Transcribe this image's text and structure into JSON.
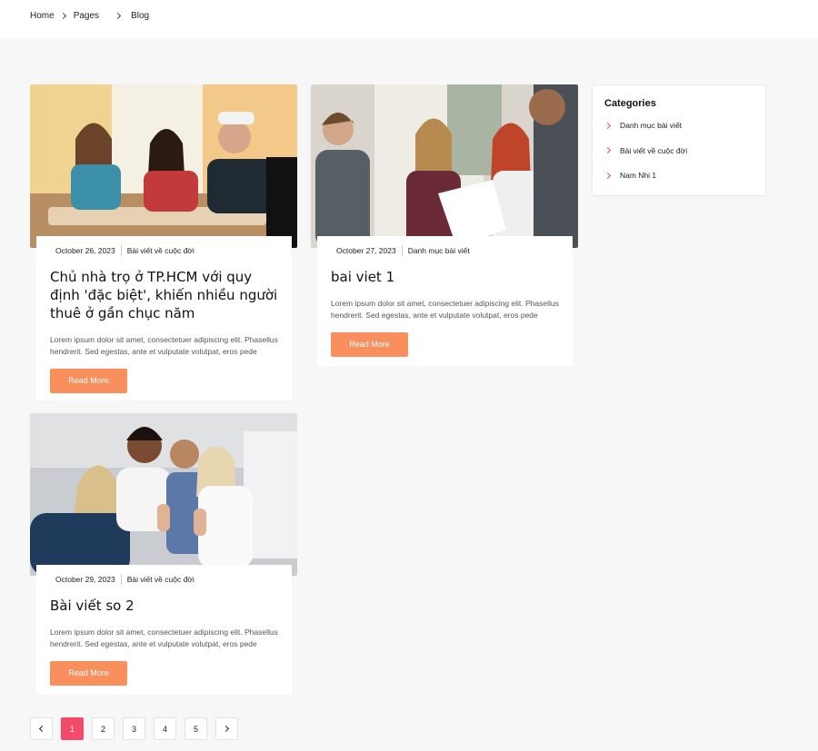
{
  "breadcrumb": {
    "home": "Home",
    "pages": "Pages",
    "current": "Blog"
  },
  "posts": [
    {
      "date": "October 26, 2023",
      "category": "Bài viết về cuộc đời",
      "title": "Chủ nhà trọ ở TP.HCM với quy định 'đặc biệt', khiến nhiều người thuê ở gần chục năm",
      "excerpt": "Lorem ipsum dolor sit amet, consectetuer adipiscing elit. Phasellus hendrerit. Sed egestas, ante et vulputate volutpat, eros pede",
      "button": "Read More",
      "image": "students-classroom-photo"
    },
    {
      "date": "October 27, 2023",
      "category": "Danh mục bài viết",
      "title": "bai viet 1",
      "excerpt": "Lorem ipsum dolor sit amet, consectetuer adipiscing elit. Phasellus hendrerit. Sed egestas, ante et vulputate volutpat, eros pede",
      "button": "Read More",
      "image": "students-discussion-photo"
    },
    {
      "date": "October 29, 2023",
      "category": "Bài viết về cuộc đời",
      "title": "Bài viết so 2",
      "excerpt": "Lorem ipsum dolor sit amet, consectetuer adipiscing elit. Phasellus hendrerit. Sed egestas, ante et vulputate volutpat, eros pede",
      "button": "Read More",
      "image": "group-thumbs-up-photo"
    }
  ],
  "sidebar": {
    "title": "Categories",
    "items": [
      "Danh mục bài viết",
      "Bài viết về cuộc đời",
      "Nam Nhi 1"
    ]
  },
  "pagination": {
    "pages": [
      "1",
      "2",
      "3",
      "4",
      "5"
    ],
    "active": "1"
  },
  "colors": {
    "accent_button": "#f98f5c",
    "active_page": "#f44b6b",
    "category_chevron": "#e84a4a",
    "page_bg": "#f7f7f7"
  },
  "icons": {
    "prev": "chevron-left-icon",
    "next": "chevron-right-icon",
    "separator": "chevron-right-icon"
  }
}
